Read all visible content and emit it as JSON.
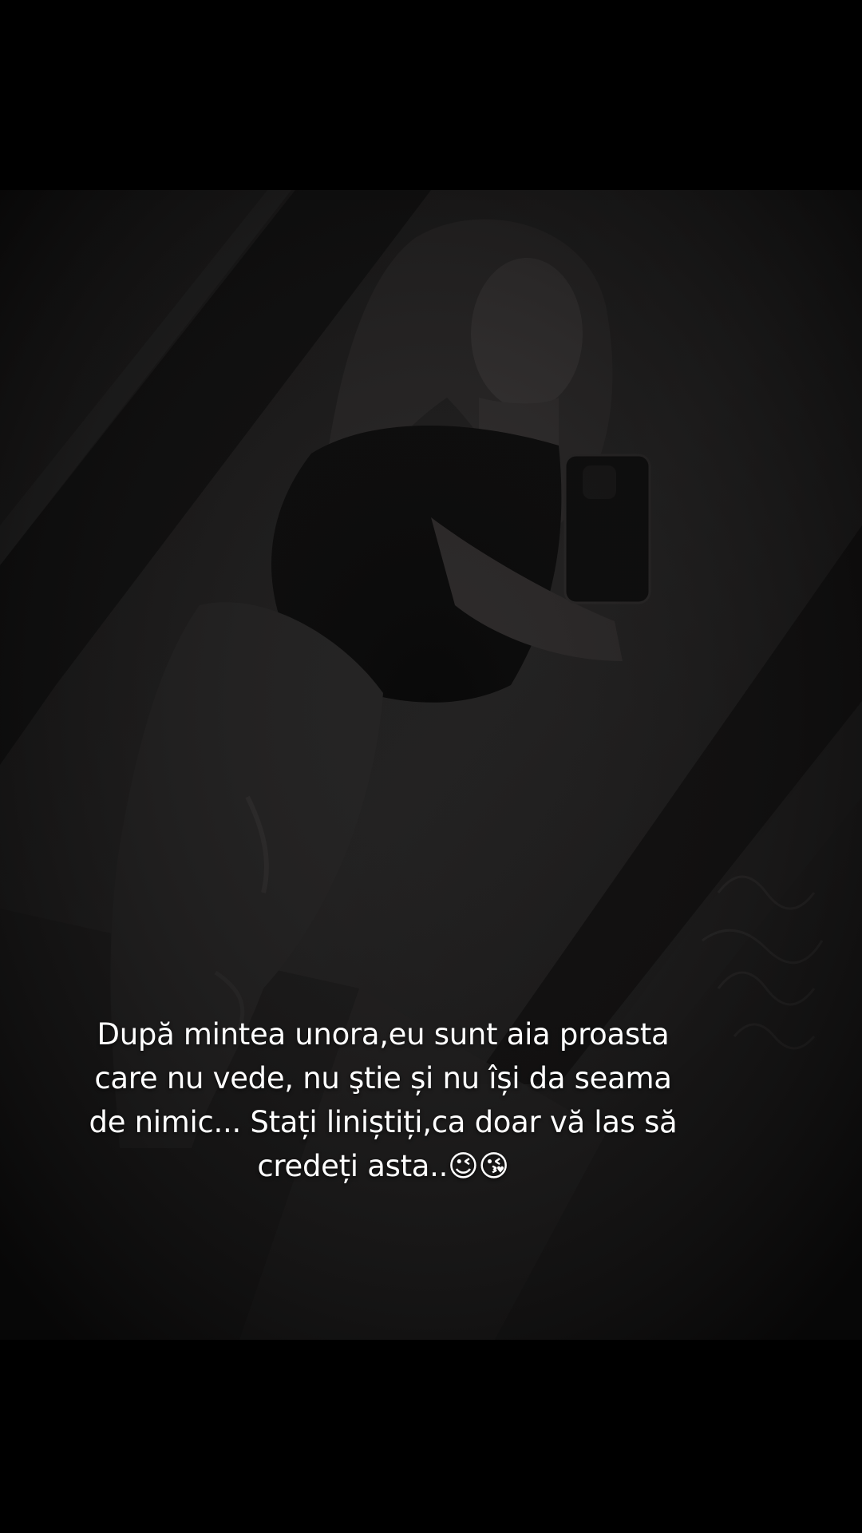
{
  "caption": {
    "lines": [
      "După mintea unora,eu sunt aia proasta",
      "care nu vede, nu ştie și nu își da seama",
      "de nimic... Stați liniștiți,ca doar vă las să",
      "credeți asta..😉😘"
    ]
  },
  "colors": {
    "letterbox": "#000000",
    "photo_tint": "#141313",
    "caption_text": "#ffffff"
  }
}
